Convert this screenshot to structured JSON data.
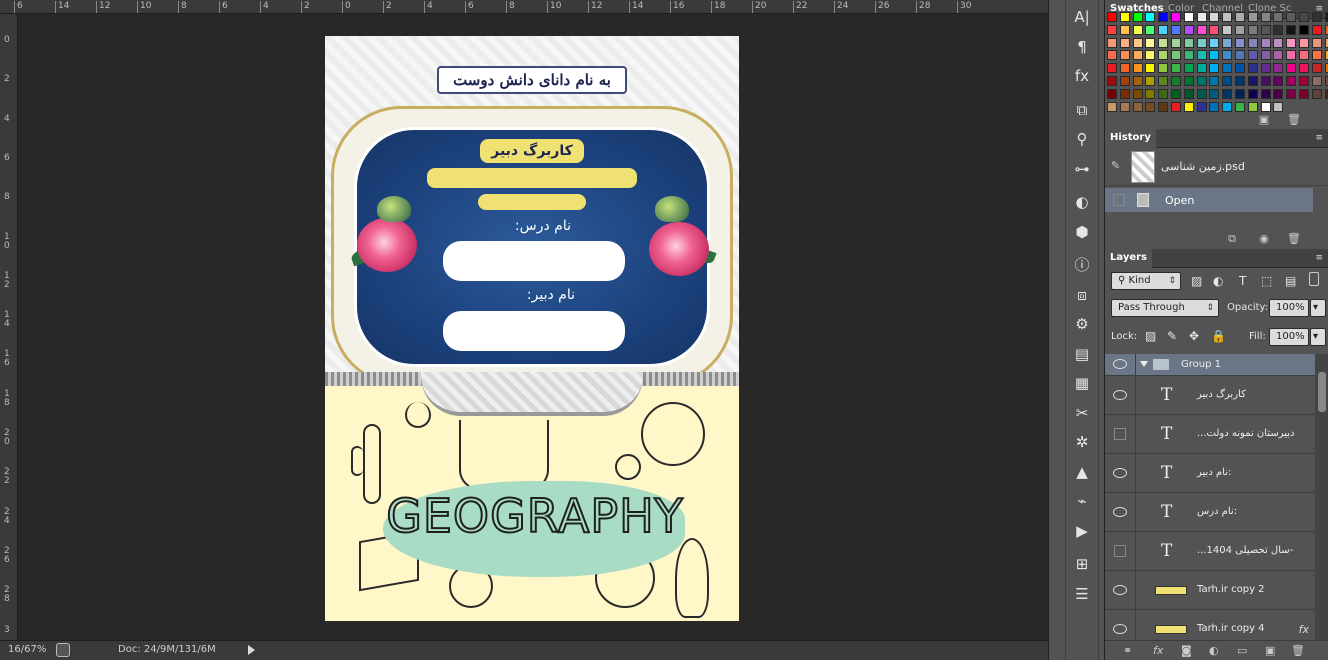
{
  "ruler_top": [
    "6",
    "14",
    "12",
    "10",
    "8",
    "6",
    "4",
    "2",
    "0",
    "2",
    "4",
    "6",
    "8",
    "10",
    "12",
    "14",
    "16",
    "18",
    "20",
    "22",
    "24",
    "26",
    "28",
    "30"
  ],
  "ruler_left": [
    "0",
    "2",
    "4",
    "6",
    "8",
    "1 0",
    "1 2",
    "1 4",
    "1 6",
    "1 8",
    "2 0",
    "2 2",
    "2 4",
    "2 6",
    "2 8",
    "3"
  ],
  "document": {
    "header": "به نام دانای دانش دوست",
    "card_title": "کاربرگ دبیر",
    "lesson_label": "نام درس:",
    "teacher_label": "نام دبیر:",
    "geo_word": "GEOGRAPHY"
  },
  "status_bar": {
    "zoom": "16/67%",
    "doc_info": "Doc: 24/9M/131/6M"
  },
  "swatches_panel": {
    "tabs": [
      "Swatches",
      "Color",
      "Channel",
      "Clone Sc"
    ],
    "rows": [
      [
        "#ff0000",
        "#ffff00",
        "#00ff00",
        "#00ffff",
        "#0000ff",
        "#ff00ff",
        "#ffffff",
        "#ebebeb",
        "#d6d6d6",
        "#c2c2c2",
        "#adadad",
        "#999999",
        "#858585",
        "#707070",
        "#5c5c5c",
        "#474747",
        "#333333",
        "#1f1f1f"
      ],
      [
        "#ff4040",
        "#ffc34d",
        "#f2ff4d",
        "#4dff79",
        "#4dd2ff",
        "#4d79ff",
        "#b24dff",
        "#ff4dd2",
        "#ff4d79",
        "#c9c9c9",
        "#a3a3a3",
        "#7d7d7d",
        "#575757",
        "#303030",
        "#141414",
        "#000000",
        "#ed1c24",
        "#f26522"
      ],
      [
        "#f7977a",
        "#f9ad81",
        "#fdc68a",
        "#fff79a",
        "#c4df9b",
        "#a2d39c",
        "#82ca9d",
        "#7bcdc8",
        "#6ecff6",
        "#7ea7d8",
        "#8493ca",
        "#8882be",
        "#a187be",
        "#bc8dbf",
        "#f49ac2",
        "#f6989d",
        "#e9967a",
        "#f4a460"
      ],
      [
        "#f26c4f",
        "#f68e55",
        "#fbaf5c",
        "#fff467",
        "#acd372",
        "#7cc576",
        "#3bb878",
        "#1abbb4",
        "#00bff3",
        "#438ccb",
        "#5574b9",
        "#605ca8",
        "#855fa8",
        "#a763a8",
        "#f06ea9",
        "#f26d7d",
        "#ff7043",
        "#ffa726"
      ],
      [
        "#ed1c24",
        "#f26522",
        "#f7941d",
        "#fff200",
        "#8dc63f",
        "#39b54a",
        "#00a651",
        "#00a99d",
        "#00aeef",
        "#0072bc",
        "#0054a6",
        "#2e3192",
        "#662d91",
        "#92278f",
        "#ec008c",
        "#ed145b",
        "#c62828",
        "#ef6c00"
      ],
      [
        "#9e0b0f",
        "#a0410d",
        "#a36209",
        "#aba000",
        "#598527",
        "#1a7b30",
        "#007236",
        "#00746b",
        "#0076a3",
        "#004b80",
        "#003471",
        "#1b1464",
        "#440e62",
        "#630460",
        "#9e005d",
        "#9e0039",
        "#8d6e63",
        "#6d4c41"
      ],
      [
        "#790000",
        "#7b2e00",
        "#7d4900",
        "#827b00",
        "#406618",
        "#005e20",
        "#005826",
        "#005952",
        "#005b7f",
        "#003663",
        "#002157",
        "#0d004c",
        "#32004b",
        "#4b0049",
        "#7b0046",
        "#7a0026",
        "#5d4037",
        "#3e2723"
      ],
      [
        "#c69c6d",
        "#a67c52",
        "#8c6239",
        "#754c24",
        "#603913",
        "#ed1c24",
        "#fff200",
        "#2e3192",
        "#0072bc",
        "#00aeef",
        "#39b54a",
        "#8dc63f",
        "#ffffff",
        "#c2c2c2"
      ]
    ]
  },
  "history_panel": {
    "tab": "History",
    "snapshot_name": "زمین شناسی.psd",
    "open_label": "Open"
  },
  "layers_panel": {
    "tab": "Layers",
    "filter_kind": "Kind",
    "blend_mode": "Pass Through",
    "opacity_label": "Opacity:",
    "opacity_value": "100%",
    "lock_label": "Lock:",
    "fill_label": "Fill:",
    "fill_value": "100%",
    "layers": [
      {
        "name": "Group 1",
        "type": "group",
        "visible": true
      },
      {
        "name": "کاربرگ دبیر",
        "type": "text",
        "visible": true
      },
      {
        "name": "...دبیرستان نمونه دولت",
        "type": "text",
        "visible": false
      },
      {
        "name": "نام دبیر:",
        "type": "text",
        "visible": true
      },
      {
        "name": "نام درس:",
        "type": "text-warp",
        "visible": true
      },
      {
        "name": "...سال تحصیلی 1404-",
        "type": "text",
        "visible": false
      },
      {
        "name": "Tarh.ir copy 2",
        "type": "shape",
        "visible": true
      },
      {
        "name": "Tarh.ir copy 4",
        "type": "shape",
        "visible": true,
        "fx": "fx"
      }
    ]
  },
  "tools": [
    "A|",
    "¶",
    "fx",
    "⧉",
    "⚲",
    "⊶",
    "◐",
    "⬢",
    "ⓘ",
    "⧈",
    "⚙",
    "▤",
    "▦",
    "✂",
    "✲",
    "▲",
    "⌁",
    "▶",
    "⊞",
    "☰"
  ]
}
